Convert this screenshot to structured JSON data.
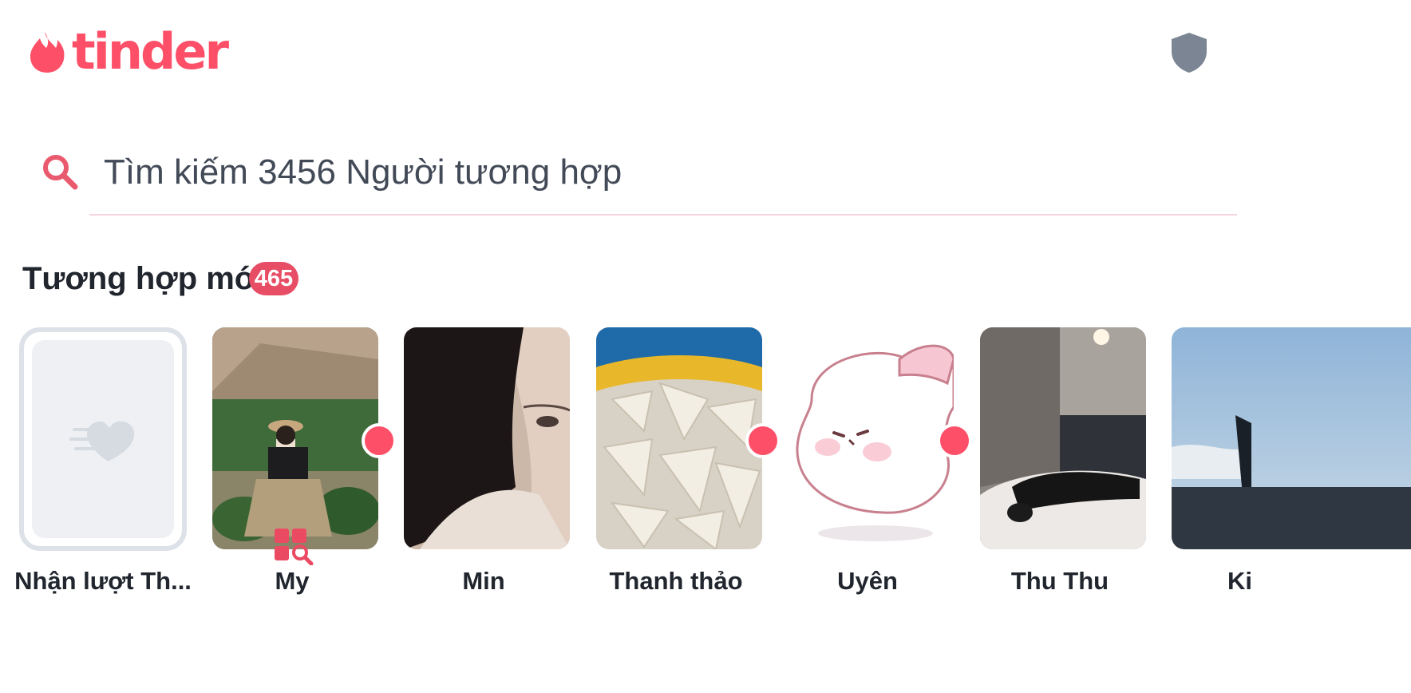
{
  "header": {
    "logo_text": "tinder"
  },
  "search": {
    "placeholder": "Tìm kiếm 3456 Người tương hợp"
  },
  "new_matches": {
    "title": "Tương hợp mới",
    "count": "465",
    "items": [
      {
        "name": "Nhận lượt Th..."
      },
      {
        "name": "My"
      },
      {
        "name": "Min"
      },
      {
        "name": "Thanh thảo"
      },
      {
        "name": "Uyên"
      },
      {
        "name": "Thu Thu"
      },
      {
        "name": "Ki"
      }
    ]
  },
  "icons": [
    "flame-logo-icon",
    "shield-icon",
    "search-icon",
    "likes-heart-icon",
    "explore-icon"
  ],
  "colors": {
    "brand": "#fd5068",
    "badge": "#e74d64",
    "text": "#21262e",
    "muted": "#424a57"
  }
}
